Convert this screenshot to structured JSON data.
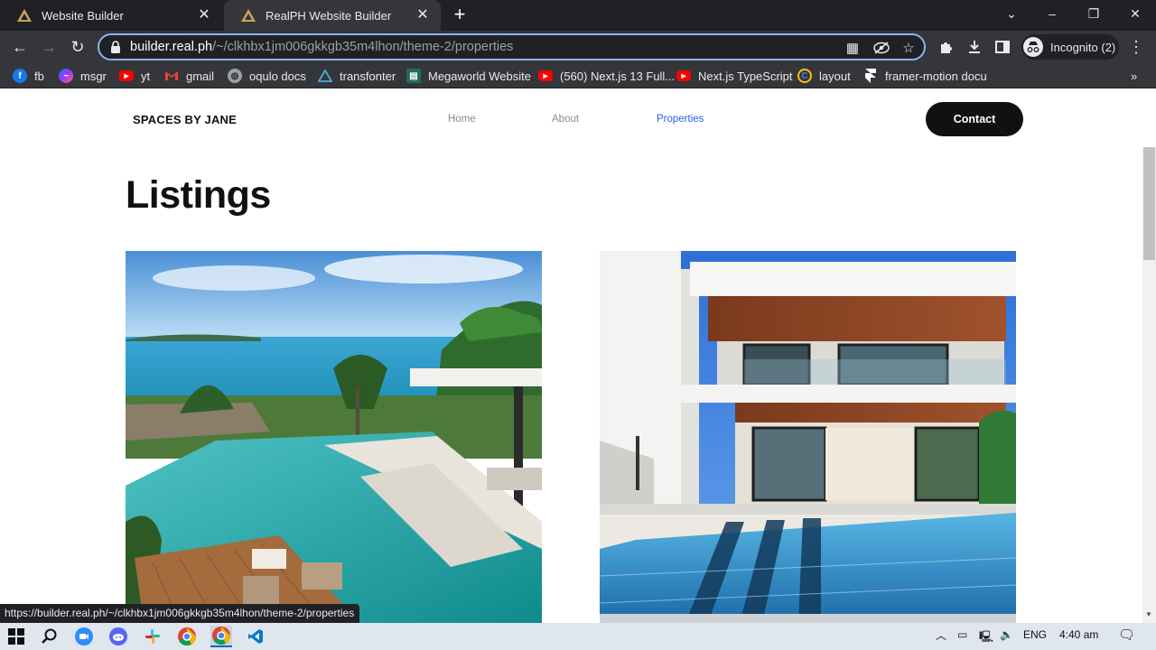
{
  "browser": {
    "tabs": [
      {
        "title": "Website Builder",
        "active": false
      },
      {
        "title": "RealPH Website Builder",
        "active": true
      }
    ],
    "url": {
      "host": "builder.real.ph",
      "path": "/~/clkhbx1jm006gkkgb35m4lhon/theme-2/properties"
    },
    "profile_label": "Incognito (2)",
    "bookmarks": [
      {
        "label": "fb",
        "icon": "facebook-icon"
      },
      {
        "label": "msgr",
        "icon": "messenger-icon"
      },
      {
        "label": "yt",
        "icon": "youtube-icon"
      },
      {
        "label": "gmail",
        "icon": "gmail-icon"
      },
      {
        "label": "oqulo docs",
        "icon": "globe-icon"
      },
      {
        "label": "transfonter",
        "icon": "triangle-icon"
      },
      {
        "label": "Megaworld Website",
        "icon": "site-icon"
      },
      {
        "label": "(560) Next.js 13 Full...",
        "icon": "youtube-icon"
      },
      {
        "label": "Next.js TypeScript",
        "icon": "youtube-icon"
      },
      {
        "label": "layout",
        "icon": "layout-icon"
      },
      {
        "label": "framer-motion docu",
        "icon": "framer-icon"
      }
    ],
    "status_url": "https://builder.real.ph/~/clkhbx1jm006gkkgb35m4lhon/theme-2/properties",
    "overflow_label": "»"
  },
  "site": {
    "brand": "SPACES BY JANE",
    "nav": [
      {
        "label": "Home",
        "active": false
      },
      {
        "label": "About",
        "active": false
      },
      {
        "label": "Properties",
        "active": true
      }
    ],
    "contact_label": "Contact",
    "heading": "Listings",
    "listings": [
      {
        "image": "tropical-infinity-pool-villa"
      },
      {
        "image": "modern-white-house-with-pool"
      }
    ]
  },
  "taskbar": {
    "language": "ENG",
    "time": "4:40 am"
  },
  "colors": {
    "accent": "#2563eb",
    "chrome_dark": "#202124",
    "chrome_toolbar": "#35363a",
    "omnibox_focus": "#8ab4f8"
  }
}
